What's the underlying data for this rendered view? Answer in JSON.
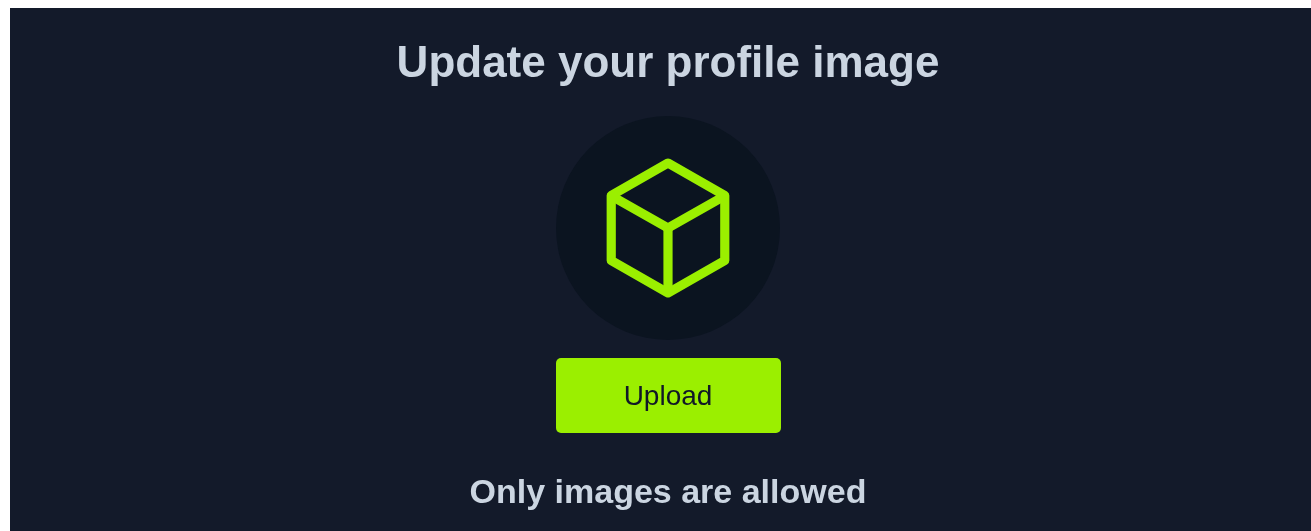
{
  "title": "Update your profile image",
  "upload_button": {
    "label": "Upload"
  },
  "note": "Only images are allowed"
}
